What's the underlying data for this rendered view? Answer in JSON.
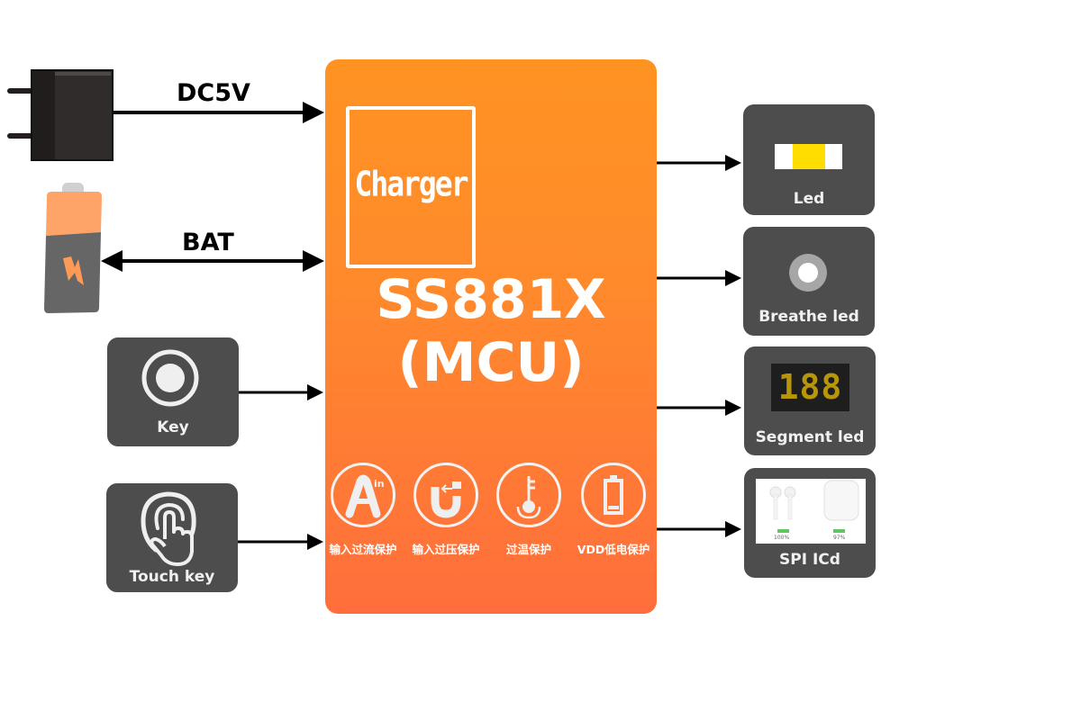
{
  "inputs": {
    "dc_label": "DC5V",
    "bat_label": "BAT",
    "key_label": "Key",
    "touch_label": "Touch key"
  },
  "mcu": {
    "charger_label": "Charger",
    "title_line1": "SS881X",
    "title_line2": "(MCU)",
    "protections": [
      {
        "icon": "current-in-icon",
        "label": "输入过流保护"
      },
      {
        "icon": "voltage-in-icon",
        "label": "输入过压保护"
      },
      {
        "icon": "temperature-icon",
        "label": "过温保护"
      },
      {
        "icon": "battery-low-icon",
        "label": "VDD低电保护"
      }
    ]
  },
  "outputs": {
    "led_label": "Led",
    "breathe_label": "Breathe led",
    "segment_label": "Segment led",
    "segment_digits": "188",
    "spi_label": "SPI ICd",
    "spi_left_battery": "100%",
    "spi_right_battery": "97%"
  },
  "colors": {
    "mcu_top": "#ff9322",
    "mcu_bottom": "#ff6e3c",
    "card": "#4d4d4d",
    "led_yellow": "#ffdd00",
    "segment_gold": "#b8960a"
  }
}
